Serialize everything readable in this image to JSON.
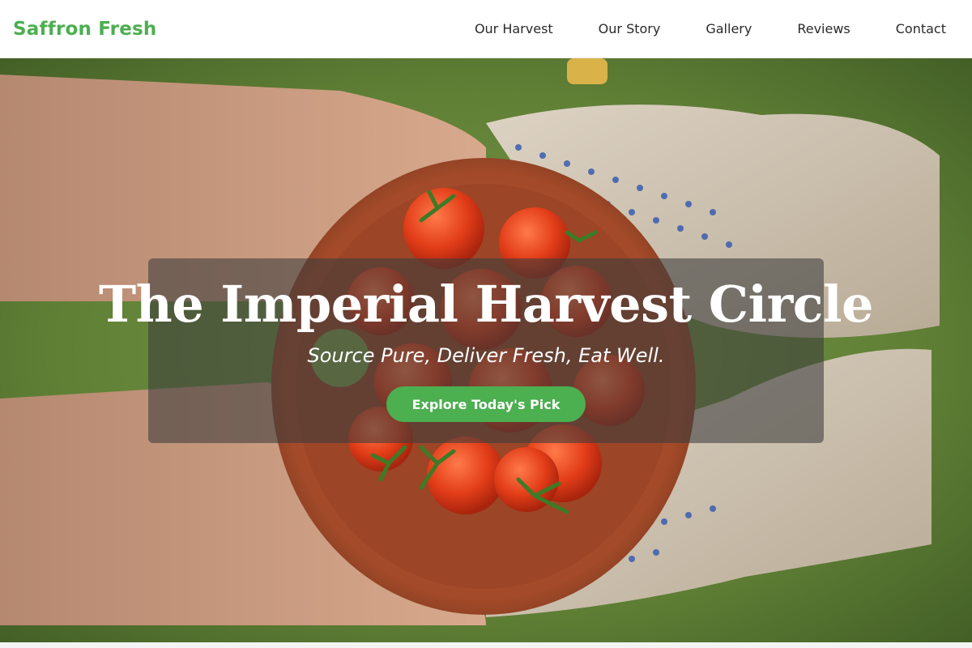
{
  "header": {
    "brand": "Saffron Fresh",
    "nav": [
      "Our Harvest",
      "Our Story",
      "Gallery",
      "Reviews",
      "Contact"
    ]
  },
  "hero": {
    "title": "The Imperial Harvest Circle",
    "subtitle": "Source Pure, Deliver Fresh, Eat Well.",
    "cta_label": "Explore Today's Pick"
  },
  "colors": {
    "brand": "#4caf50",
    "cta": "#4caf50",
    "nav_text": "#2a2a2a"
  }
}
